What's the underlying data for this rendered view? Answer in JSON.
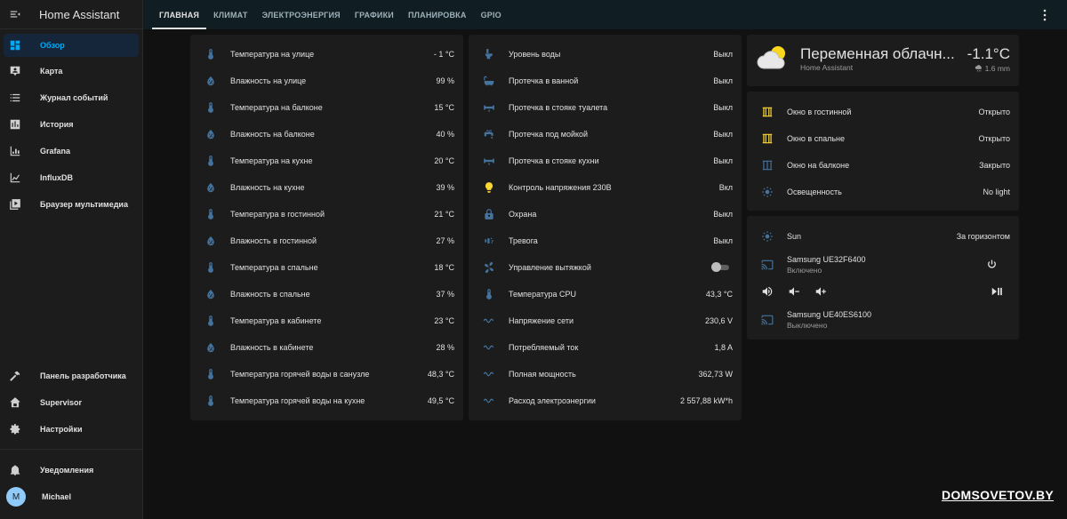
{
  "app": {
    "title": "Home Assistant"
  },
  "sidebar": {
    "items": [
      {
        "label": "Обзор",
        "icon": "dashboard-icon"
      },
      {
        "label": "Карта",
        "icon": "map-icon"
      },
      {
        "label": "Журнал событий",
        "icon": "logbook-icon"
      },
      {
        "label": "История",
        "icon": "history-icon"
      },
      {
        "label": "Grafana",
        "icon": "grafana-icon"
      },
      {
        "label": "InfluxDB",
        "icon": "influxdb-icon"
      },
      {
        "label": "Браузер мультимедиа",
        "icon": "media-browser-icon"
      }
    ],
    "bottom_items": [
      {
        "label": "Панель разработчика",
        "icon": "hammer-icon"
      },
      {
        "label": "Supervisor",
        "icon": "supervisor-icon"
      },
      {
        "label": "Настройки",
        "icon": "gear-icon"
      }
    ],
    "notifications": "Уведомления",
    "user": {
      "initial": "M",
      "name": "Michael"
    }
  },
  "tabs": [
    "ГЛАВНАЯ",
    "КЛИМАТ",
    "ЭЛЕКТРОЭНЕРГИЯ",
    "ГРАФИКИ",
    "ПЛАНИРОВКА",
    "GPIO"
  ],
  "card1": {
    "rows": [
      {
        "name": "Температура на улице",
        "value": "- 1 °C",
        "icon": "thermometer-icon"
      },
      {
        "name": "Влажность на улице",
        "value": "99 %",
        "icon": "water-percent-icon"
      },
      {
        "name": "Температура на балконе",
        "value": "15 °C",
        "icon": "thermometer-icon"
      },
      {
        "name": "Влажность на балконе",
        "value": "40 %",
        "icon": "water-percent-icon"
      },
      {
        "name": "Температура на кухне",
        "value": "20 °C",
        "icon": "thermometer-icon"
      },
      {
        "name": "Влажность на кухне",
        "value": "39 %",
        "icon": "water-percent-icon"
      },
      {
        "name": "Температура в гостинной",
        "value": "21 °C",
        "icon": "thermometer-icon"
      },
      {
        "name": "Влажность в гостинной",
        "value": "27 %",
        "icon": "water-percent-icon"
      },
      {
        "name": "Температура в спальне",
        "value": "18 °C",
        "icon": "thermometer-icon"
      },
      {
        "name": "Влажность в спальне",
        "value": "37 %",
        "icon": "water-percent-icon"
      },
      {
        "name": "Температура в кабинете",
        "value": "23 °C",
        "icon": "thermometer-icon"
      },
      {
        "name": "Влажность в кабинете",
        "value": "28 %",
        "icon": "water-percent-icon"
      },
      {
        "name": "Температура горячей воды в санузле",
        "value": "48,3 °C",
        "icon": "thermometer-icon"
      },
      {
        "name": "Температура горячей воды на кухне",
        "value": "49,5 °C",
        "icon": "thermometer-icon"
      }
    ]
  },
  "card2": {
    "rows": [
      {
        "name": "Уровень воды",
        "value": "Выкл",
        "icon": "toilet-icon"
      },
      {
        "name": "Протечка в ванной",
        "value": "Выкл",
        "icon": "bathtub-icon"
      },
      {
        "name": "Протечка в стояке туалета",
        "value": "Выкл",
        "icon": "pipe-icon"
      },
      {
        "name": "Протечка под мойкой",
        "value": "Выкл",
        "icon": "faucet-icon"
      },
      {
        "name": "Протечка в стояке кухни",
        "value": "Выкл",
        "icon": "pipe-icon"
      },
      {
        "name": "Контроль напряжения 230В",
        "value": "Вкл",
        "icon": "lightbulb-icon"
      },
      {
        "name": "Охрана",
        "value": "Выкл",
        "icon": "lock-icon"
      },
      {
        "name": "Тревога",
        "value": "Выкл",
        "icon": "alarm-speaker-icon"
      },
      {
        "name": "Управление вытяжкой",
        "value": "",
        "icon": "fan-icon",
        "toggle": true
      },
      {
        "name": "Температура CPU",
        "value": "43,3 °C",
        "icon": "thermometer-icon"
      },
      {
        "name": "Напряжение сети",
        "value": "230,6 V",
        "icon": "sine-wave-icon"
      },
      {
        "name": "Потребляемый ток",
        "value": "1,8 A",
        "icon": "sine-wave-icon"
      },
      {
        "name": "Полная мощность",
        "value": "362,73 W",
        "icon": "sine-wave-icon"
      },
      {
        "name": "Расход электроэнергии",
        "value": "2 557,88 kW*h",
        "icon": "sine-wave-icon"
      }
    ]
  },
  "weather": {
    "state": "Переменная облачн...",
    "source": "Home Assistant",
    "temperature": "-1.1°C",
    "precipitation": "1.6 mm",
    "icon": "partly-cloudy-icon"
  },
  "card4": {
    "rows": [
      {
        "name": "Окно в гостинной",
        "value": "Открыто",
        "icon": "window-open-icon"
      },
      {
        "name": "Окно в спальне",
        "value": "Открыто",
        "icon": "window-open-icon"
      },
      {
        "name": "Окно на балконе",
        "value": "Закрыто",
        "icon": "window-closed-icon"
      },
      {
        "name": "Освещенность",
        "value": "No light",
        "icon": "brightness-icon"
      }
    ]
  },
  "card5": {
    "sun": {
      "name": "Sun",
      "value": "За горизонтом"
    },
    "tv1": {
      "name": "Samsung UE32F6400",
      "state": "Включено"
    },
    "tv2": {
      "name": "Samsung UE40ES6100",
      "state": "Выключено"
    }
  },
  "watermark": "DOMSOVETOV.BY",
  "colors": {
    "accent": "#03a9f4",
    "icon_blue": "#44739e",
    "window_open": "#fdd835",
    "bulb_on": "#fdd835"
  }
}
